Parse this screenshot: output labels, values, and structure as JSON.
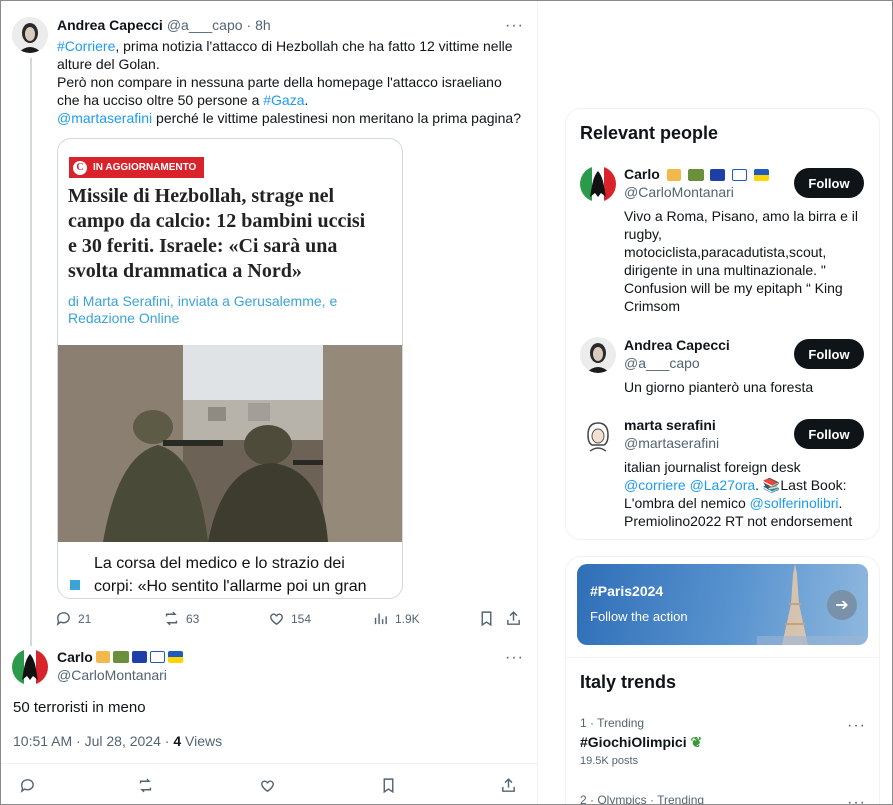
{
  "post": {
    "author_name": "Andrea Capecci",
    "author_handle": "@a___capo",
    "time": "· 8h",
    "more": "···",
    "line1_link": "#Corriere",
    "line1_rest": ", prima notizia l'attacco di Hezbollah che ha fatto 12 vittime nelle alture del Golan.",
    "line2_text": "Però non compare in nessuna parte della homepage l'attacco israeliano che ha ucciso oltre 50 persone a ",
    "line2_link": "#Gaza",
    "line2_end": ".",
    "line3_link": "@martaserafini",
    "line3_rest": " perché le vittime palestinesi non meritano la prima pagina?",
    "card": {
      "badge": "IN AGGIORNAMENTO",
      "badge_logo": "C",
      "headline": "Missile di Hezbollah, strage nel campo da calcio: 12 bambini uccisi e 30 feriti. Israele: «Ci sarà una svolta drammatica a Nord»",
      "byline": "di Marta Serafini, inviata a Gerusalemme, e Redazione Online",
      "subheadline": "La corsa del medico e lo strazio dei corpi: «Ho sentito l'allarme poi un gran"
    },
    "actions": {
      "replies": "21",
      "reposts": "63",
      "likes": "154",
      "views": "1.9K"
    }
  },
  "reply": {
    "author_name": "Carlo",
    "author_handle": "@CarloMontanari",
    "more": "···",
    "text": "50 terroristi in meno",
    "time": "10:51 AM · Jul 28, 2024 · ",
    "views_count": "4",
    "views_label": " Views"
  },
  "sidebar": {
    "relevant_title": "Relevant people",
    "people": [
      {
        "name": "Carlo",
        "handle": "@CarloMontanari",
        "follow": "Follow",
        "bio": "Vivo a Roma, Pisano, amo la birra e il rugby, motociclista,paracadutista,scout, dirigente in una multinazionale. \" Confusion will be my epitaph “ King Crimsom"
      },
      {
        "name": "Andrea Capecci",
        "handle": "@a___capo",
        "follow": "Follow",
        "bio": "Un giorno pianterò una foresta"
      },
      {
        "name": "marta serafini",
        "handle": "@martaserafini",
        "follow": "Follow",
        "bio_part1": "italian journalist foreign desk ",
        "bio_link1": "@corriere",
        "bio_link2": "@La27ora",
        "bio_part2": ". 📚Last Book: L'ombra del nemico ",
        "bio_link3": "@solferinolibri",
        "bio_part3": ". Premiolino2022 RT not endorsement"
      }
    ],
    "promo": {
      "title": "#Paris2024",
      "subtitle": "Follow the action"
    },
    "trends_title": "Italy trends",
    "trends": [
      {
        "meta": "1 · Trending",
        "name": "#GiochiOlimpici",
        "posts": "19.5K posts"
      },
      {
        "meta": "2 · Olympics · Trending",
        "name": "",
        "posts": ""
      }
    ],
    "trend_more": "···"
  },
  "colors": {
    "link": "#1d9bf0",
    "text": "#0f1419",
    "muted": "#536471",
    "badge_red": "#d8232a",
    "byline_blue": "#3aa3d8"
  },
  "icons": [
    "reply-icon",
    "repost-icon",
    "like-icon",
    "views-icon",
    "bookmark-icon",
    "share-icon",
    "more-icon",
    "arrow-right-icon"
  ]
}
